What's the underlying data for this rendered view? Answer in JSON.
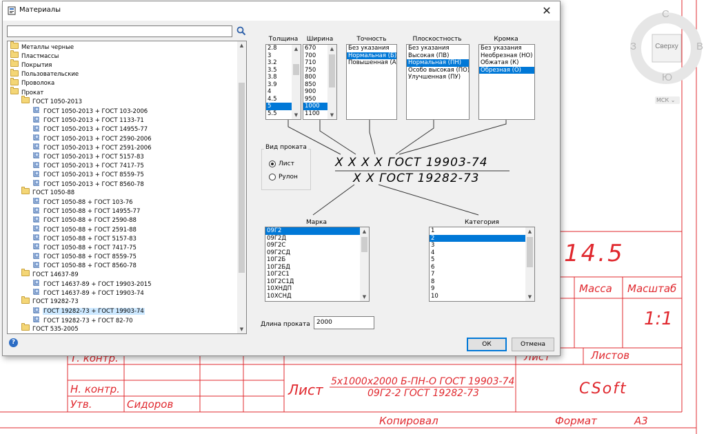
{
  "dialog": {
    "title": "Материалы",
    "close": "✕",
    "search": {
      "value": "",
      "placeholder": ""
    },
    "tree": [
      {
        "label": "Металлы черные",
        "level": 0,
        "type": "folder"
      },
      {
        "label": "Пластмассы",
        "level": 0,
        "type": "folder"
      },
      {
        "label": "Покрытия",
        "level": 0,
        "type": "folder"
      },
      {
        "label": "Пользовательские",
        "level": 0,
        "type": "folder"
      },
      {
        "label": "Проволока",
        "level": 0,
        "type": "folder"
      },
      {
        "label": "Прокат",
        "level": 0,
        "type": "folder"
      },
      {
        "label": "ГОСТ 1050-2013",
        "level": 1,
        "type": "folder"
      },
      {
        "label": "ГОСТ 1050-2013 + ГОСТ 103-2006",
        "level": 2,
        "type": "item"
      },
      {
        "label": "ГОСТ 1050-2013 + ГОСТ 1133-71",
        "level": 2,
        "type": "item"
      },
      {
        "label": "ГОСТ 1050-2013 + ГОСТ 14955-77",
        "level": 2,
        "type": "item"
      },
      {
        "label": "ГОСТ 1050-2013 + ГОСТ 2590-2006",
        "level": 2,
        "type": "item"
      },
      {
        "label": "ГОСТ 1050-2013 + ГОСТ 2591-2006",
        "level": 2,
        "type": "item"
      },
      {
        "label": "ГОСТ 1050-2013 + ГОСТ 5157-83",
        "level": 2,
        "type": "item"
      },
      {
        "label": "ГОСТ 1050-2013 + ГОСТ 7417-75",
        "level": 2,
        "type": "item"
      },
      {
        "label": "ГОСТ 1050-2013 + ГОСТ 8559-75",
        "level": 2,
        "type": "item"
      },
      {
        "label": "ГОСТ 1050-2013 + ГОСТ 8560-78",
        "level": 2,
        "type": "item"
      },
      {
        "label": "ГОСТ 1050-88",
        "level": 1,
        "type": "folder"
      },
      {
        "label": "ГОСТ 1050-88 + ГОСТ 103-76",
        "level": 2,
        "type": "item"
      },
      {
        "label": "ГОСТ 1050-88 + ГОСТ 14955-77",
        "level": 2,
        "type": "item"
      },
      {
        "label": "ГОСТ 1050-88 + ГОСТ 2590-88",
        "level": 2,
        "type": "item"
      },
      {
        "label": "ГОСТ 1050-88 + ГОСТ 2591-88",
        "level": 2,
        "type": "item"
      },
      {
        "label": "ГОСТ 1050-88 + ГОСТ 5157-83",
        "level": 2,
        "type": "item"
      },
      {
        "label": "ГОСТ 1050-88 + ГОСТ 7417-75",
        "level": 2,
        "type": "item"
      },
      {
        "label": "ГОСТ 1050-88 + ГОСТ 8559-75",
        "level": 2,
        "type": "item"
      },
      {
        "label": "ГОСТ 1050-88 + ГОСТ 8560-78",
        "level": 2,
        "type": "item"
      },
      {
        "label": "ГОСТ 14637-89",
        "level": 1,
        "type": "folder"
      },
      {
        "label": "ГОСТ 14637-89 + ГОСТ 19903-2015",
        "level": 2,
        "type": "item"
      },
      {
        "label": "ГОСТ 14637-89 + ГОСТ 19903-74",
        "level": 2,
        "type": "item"
      },
      {
        "label": "ГОСТ 19282-73",
        "level": 1,
        "type": "folder"
      },
      {
        "label": "ГОСТ 19282-73 + ГОСТ 19903-74",
        "level": 2,
        "type": "item",
        "selected": true
      },
      {
        "label": "ГОСТ 19282-73 + ГОСТ 82-70",
        "level": 2,
        "type": "item"
      },
      {
        "label": "ГОСТ 535-2005",
        "level": 1,
        "type": "folder"
      }
    ],
    "columns": {
      "thickness": {
        "label": "Толщина",
        "items": [
          "2.8",
          "3",
          "3.2",
          "3.5",
          "3.8",
          "3.9",
          "4",
          "4.5",
          "5",
          "5.5"
        ],
        "selected": 8
      },
      "width": {
        "label": "Ширина",
        "items": [
          "670",
          "700",
          "710",
          "750",
          "800",
          "850",
          "900",
          "950",
          "1000",
          "1100"
        ],
        "selected": 8
      },
      "accuracy": {
        "label": "Точность",
        "items": [
          "Без указания",
          "Нормальная (Б)",
          "Повышенная (А)"
        ],
        "selected": 1
      },
      "flatness": {
        "label": "Плоскостность",
        "items": [
          "Без указания",
          "Высокая (ПВ)",
          "Нормальная (ПН)",
          "Особо высокая (ПО)",
          "Улучшенная (ПУ)"
        ],
        "selected": 2
      },
      "edge": {
        "label": "Кромка",
        "items": [
          "Без указания",
          "Необрезная (НО)",
          "Обжатая (К)",
          "Обрезная (О)"
        ],
        "selected": 3
      }
    },
    "rolling_type": {
      "label": "Вид проката",
      "options": [
        {
          "label": "Лист",
          "checked": true
        },
        {
          "label": "Рулон",
          "checked": false
        }
      ]
    },
    "formula": {
      "top": "X X X X ГОСТ 19903-74",
      "bottom": "X X ГОСТ 19282-73"
    },
    "grade": {
      "label": "Марка",
      "items": [
        "09Г2",
        "09Г2Д",
        "09Г2С",
        "09Г2СД",
        "10Г2Б",
        "10Г2БД",
        "10Г2С1",
        "10Г2С1Д",
        "10ХНДП",
        "10ХСНД"
      ],
      "selected": 0
    },
    "category": {
      "label": "Категория",
      "items": [
        "1",
        "2",
        "3",
        "4",
        "5",
        "6",
        "7",
        "8",
        "9",
        "10"
      ],
      "selected": 1
    },
    "length": {
      "label": "Длина проката",
      "value": "2000"
    },
    "ok": "ОК",
    "cancel": "Отмена",
    "help": "?"
  },
  "drawing": {
    "mass_value": "14.5",
    "mass": "Масса",
    "scale": "Масштаб",
    "scale_value": "1:1",
    "t_control": "Т. контр.",
    "sheet": "Лист",
    "sheets": "Листов",
    "n_control": "Н. контр.",
    "approved": "Утв.",
    "approver": "Сидоров",
    "title_word": "Лист",
    "title_top": "5x1000x2000 Б-ПН-О ГОСТ 19903-74",
    "title_bottom": "09Г2-2 ГОСТ 19282-73",
    "company": "CSoft",
    "copied": "Копировал",
    "format": "Формат",
    "format_value": "А3"
  },
  "viewcube": {
    "north": "С",
    "west": "З",
    "east": "В",
    "south": "Ю",
    "face": "Сверху",
    "ucs": "МСК"
  }
}
